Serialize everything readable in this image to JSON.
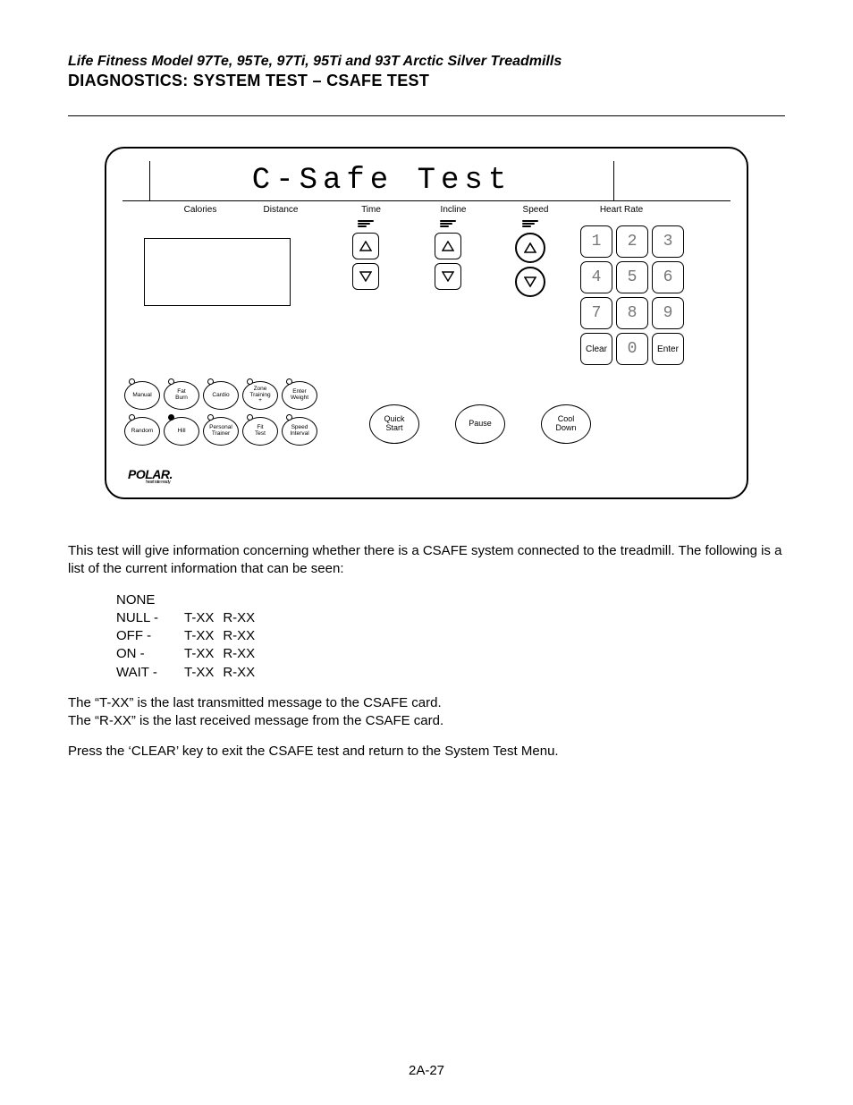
{
  "header": {
    "model_line": "Life Fitness Model 97Te, 95Te, 97Ti, 95Ti and 93T Arctic Silver Treadmills",
    "section": "DIAGNOSTICS: SYSTEM TEST – CSAFE TEST"
  },
  "console": {
    "title": "C-Safe Test",
    "columns": {
      "calories": "Calories",
      "distance": "Distance",
      "time": "Time",
      "incline": "Incline",
      "speed": "Speed",
      "heart_rate": "Heart Rate"
    },
    "keypad": [
      "1",
      "2",
      "3",
      "4",
      "5",
      "6",
      "7",
      "8",
      "9",
      "Clear",
      "0",
      "Enter"
    ],
    "programs_row1": [
      "Manual",
      "Fat\nBurn",
      "Cardio",
      "Zone\nTraining\n+",
      "Enter\nWeight"
    ],
    "programs_row2": [
      "Random",
      "Hill",
      "Personal\nTrainer",
      "Fit\nTest",
      "Speed\nInterval"
    ],
    "lower_buttons": {
      "quick_start": "Quick\nStart",
      "pause": "Pause",
      "cool_down": "Cool\nDown"
    },
    "brand": "POLAR.",
    "brand_sub": "heart rate ready"
  },
  "body": {
    "p1": "This test will give information concerning whether there is a CSAFE system connected to the treadmill. The following is a list of the current information that can be seen:",
    "states": [
      [
        "NONE",
        "",
        ""
      ],
      [
        "NULL -",
        "T-XX",
        "R-XX"
      ],
      [
        "OFF -",
        "T-XX",
        "R-XX"
      ],
      [
        "ON  -",
        "T-XX",
        "R-XX"
      ],
      [
        "WAIT -",
        "T-XX",
        "R-XX"
      ]
    ],
    "p2": "The “T-XX” is the last transmitted message to the CSAFE card.",
    "p3": "The “R-XX” is the last received message from the CSAFE card.",
    "p4": "Press the ‘CLEAR’ key to exit the CSAFE test and return to the System Test Menu."
  },
  "page_number": "2A-27"
}
